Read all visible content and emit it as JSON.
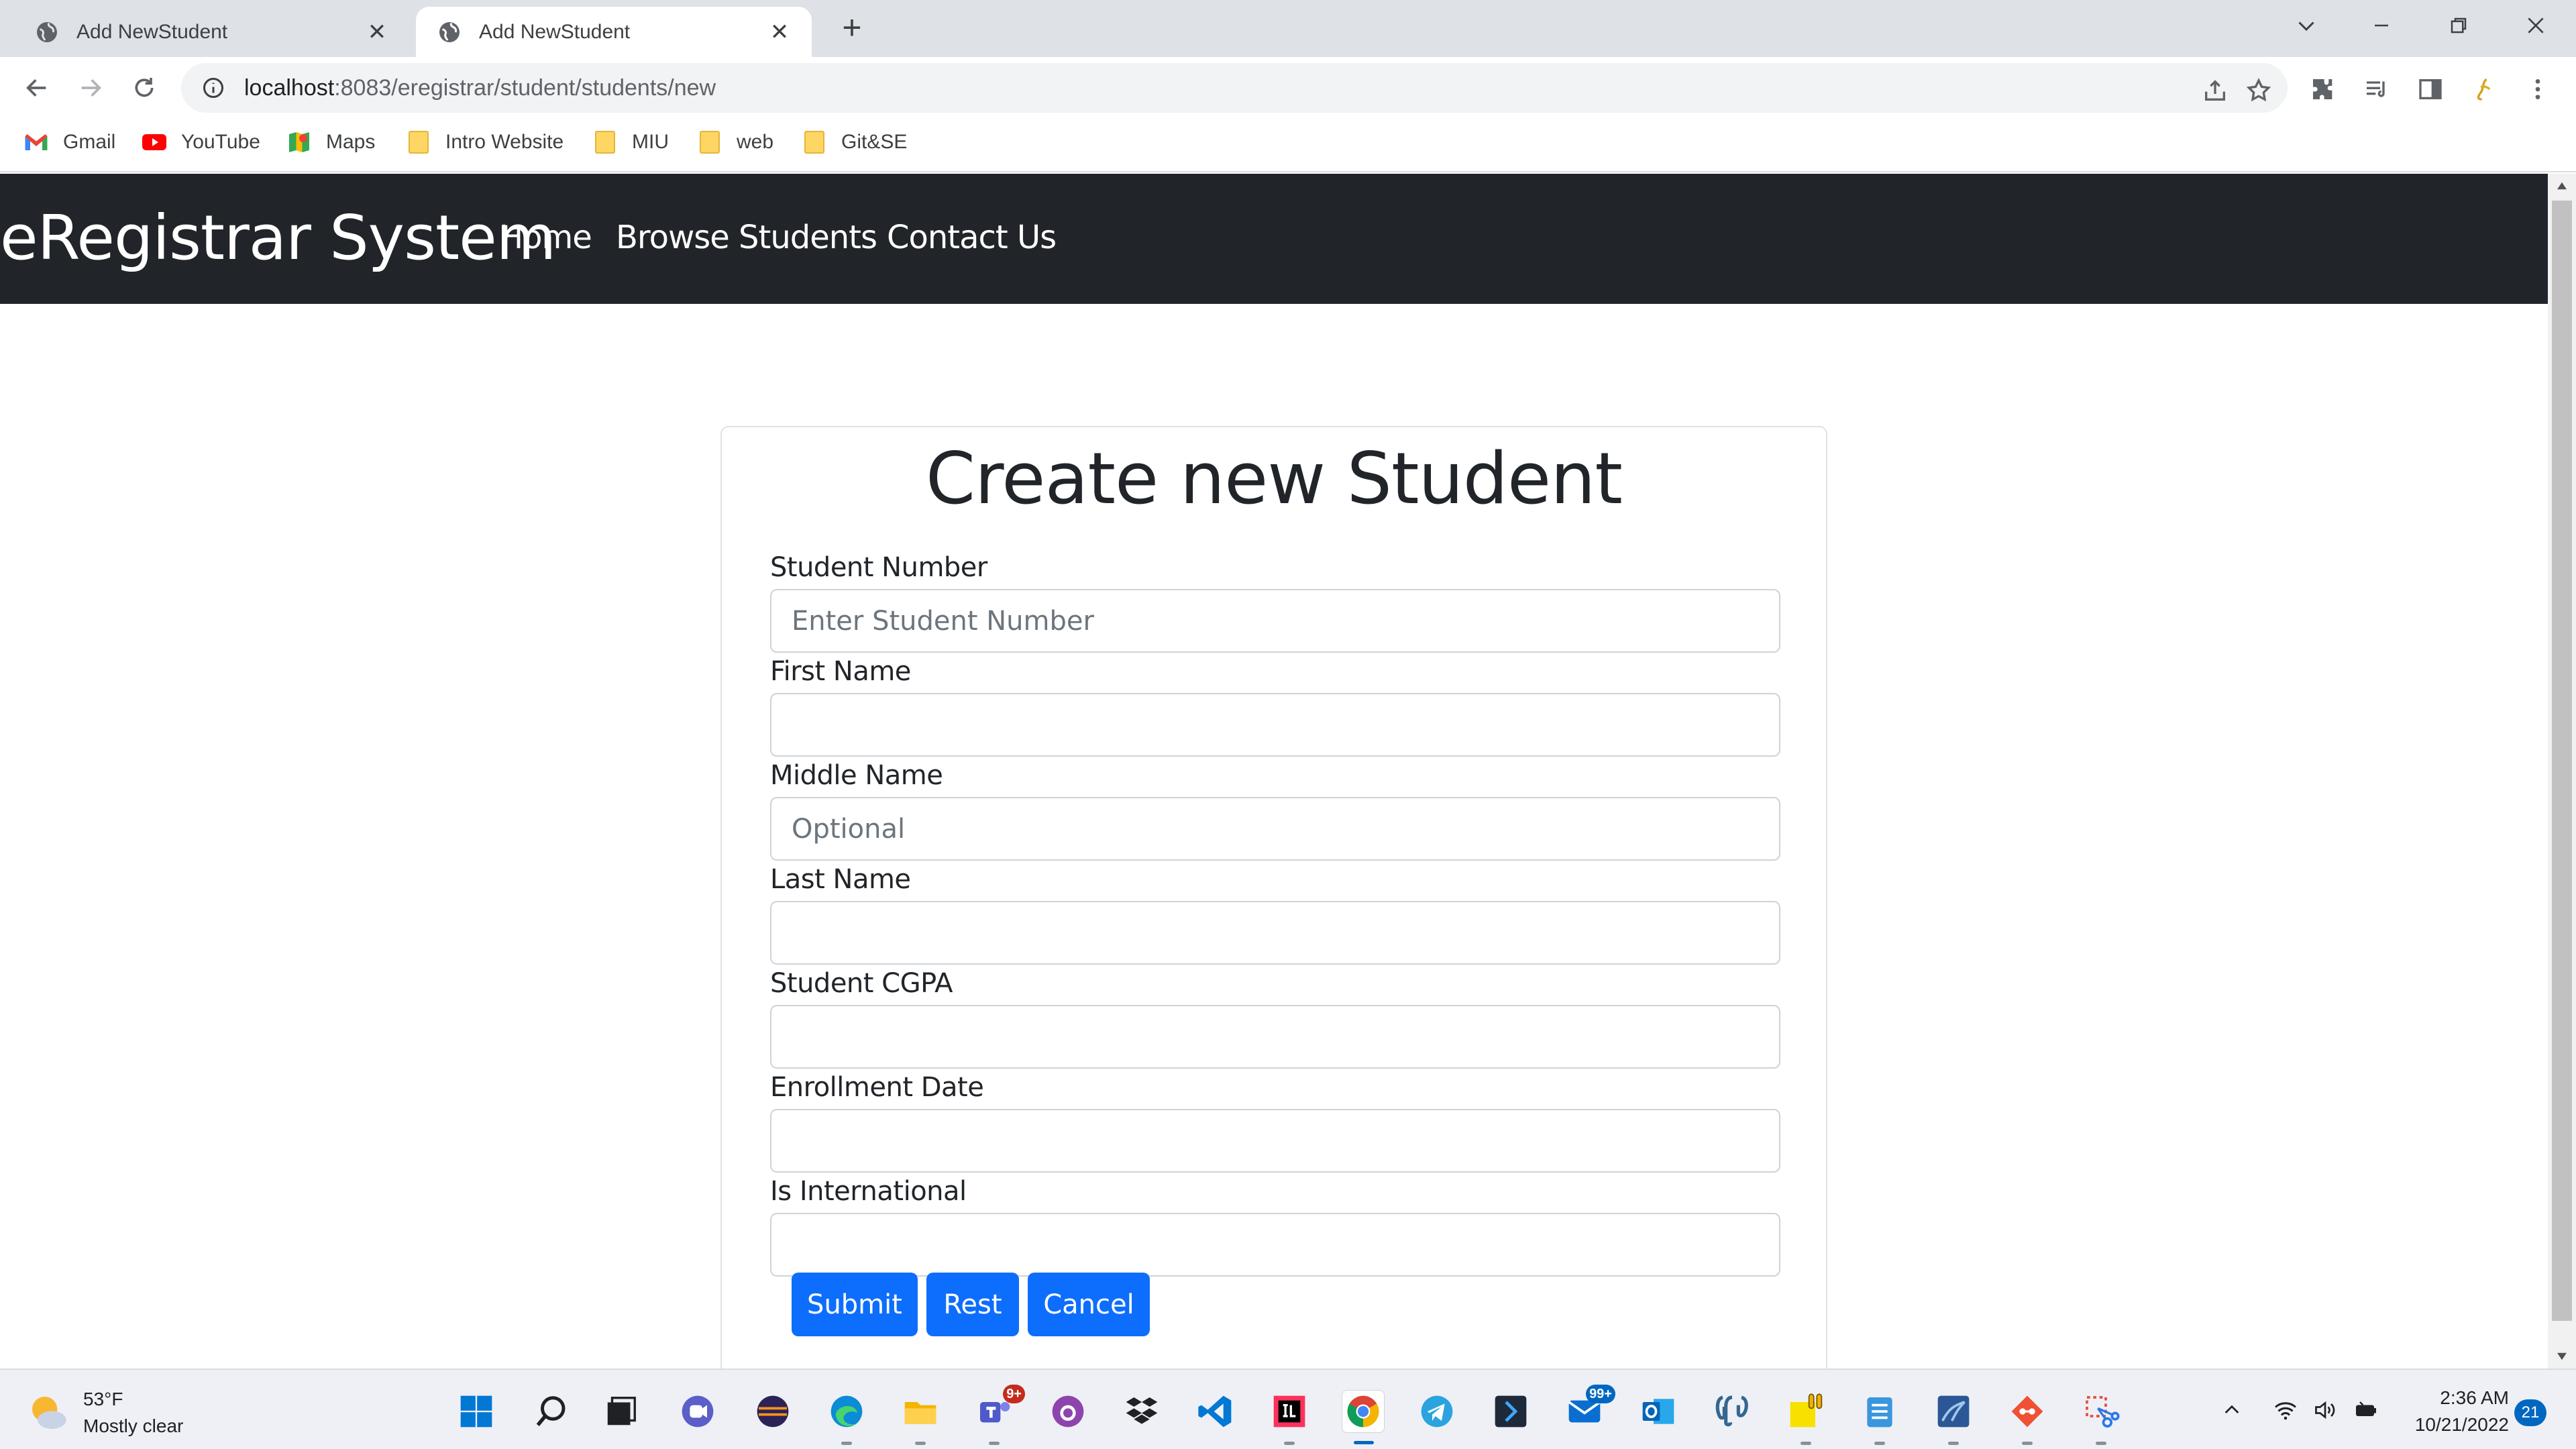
{
  "browser": {
    "tabs": [
      {
        "title": "Add NewStudent",
        "active": false
      },
      {
        "title": "Add NewStudent",
        "active": true
      }
    ],
    "url_host": "localhost",
    "url_rest": ":8083/eregistrar/student/students/new",
    "bookmarks": [
      {
        "label": "Gmail",
        "icon": "gmail-icon"
      },
      {
        "label": "YouTube",
        "icon": "youtube-icon"
      },
      {
        "label": "Maps",
        "icon": "maps-icon"
      },
      {
        "label": "Intro Website",
        "icon": "folder-icon"
      },
      {
        "label": "MIU",
        "icon": "folder-icon"
      },
      {
        "label": "web",
        "icon": "folder-icon"
      },
      {
        "label": "Git&SE",
        "icon": "folder-icon"
      }
    ]
  },
  "navbar": {
    "brand": "eRegistrar System",
    "links": [
      "Home",
      "Browse Students",
      "Contact Us"
    ]
  },
  "form": {
    "title": "Create new Student",
    "fields": [
      {
        "label": "Student Number",
        "placeholder": "Enter Student Number",
        "value": ""
      },
      {
        "label": "First Name",
        "placeholder": "",
        "value": ""
      },
      {
        "label": "Middle Name",
        "placeholder": "Optional",
        "value": ""
      },
      {
        "label": "Last Name",
        "placeholder": "",
        "value": ""
      },
      {
        "label": "Student CGPA",
        "placeholder": "",
        "value": ""
      },
      {
        "label": "Enrollment Date",
        "placeholder": "",
        "value": ""
      },
      {
        "label": "Is International",
        "placeholder": "",
        "value": ""
      }
    ],
    "buttons": {
      "submit": "Submit",
      "reset": "Rest",
      "cancel": "Cancel"
    }
  },
  "taskbar": {
    "weather": {
      "temp": "53°F",
      "condition": "Mostly clear"
    },
    "badges": {
      "teams": "9+",
      "mail": "99+"
    },
    "clock": {
      "time": "2:36 AM",
      "date": "10/21/2022"
    },
    "notifications": "21"
  },
  "colors": {
    "navbar_bg": "#212529",
    "primary": "#0d6efd",
    "tabstrip_bg": "#dee1e6"
  }
}
